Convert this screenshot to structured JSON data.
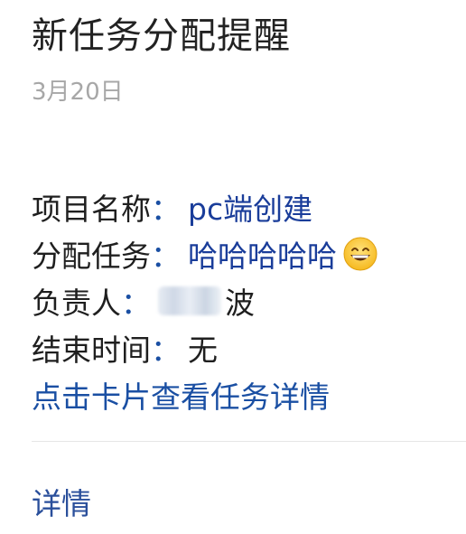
{
  "card": {
    "title": "新任务分配提醒",
    "date": "3月20日"
  },
  "fields": {
    "project": {
      "label": "项目名称",
      "colon": "：",
      "value": "pc端创建"
    },
    "task": {
      "label": "分配任务",
      "colon": "：",
      "value": "哈哈哈哈哈",
      "emoji_icon": "grinning-face-icon"
    },
    "owner": {
      "label": "负责人",
      "colon": "：",
      "value": "波",
      "redacted": true
    },
    "end_time": {
      "label": "结束时间",
      "colon": "：",
      "value": "无"
    }
  },
  "link": {
    "text": "点击卡片查看任务详情"
  },
  "footer": {
    "details_label": "详情"
  },
  "colors": {
    "link_blue": "#1a4fa3",
    "text_dark": "#1f1f1f",
    "date_gray": "#a7a7a7",
    "divider": "#e6e6e6"
  }
}
